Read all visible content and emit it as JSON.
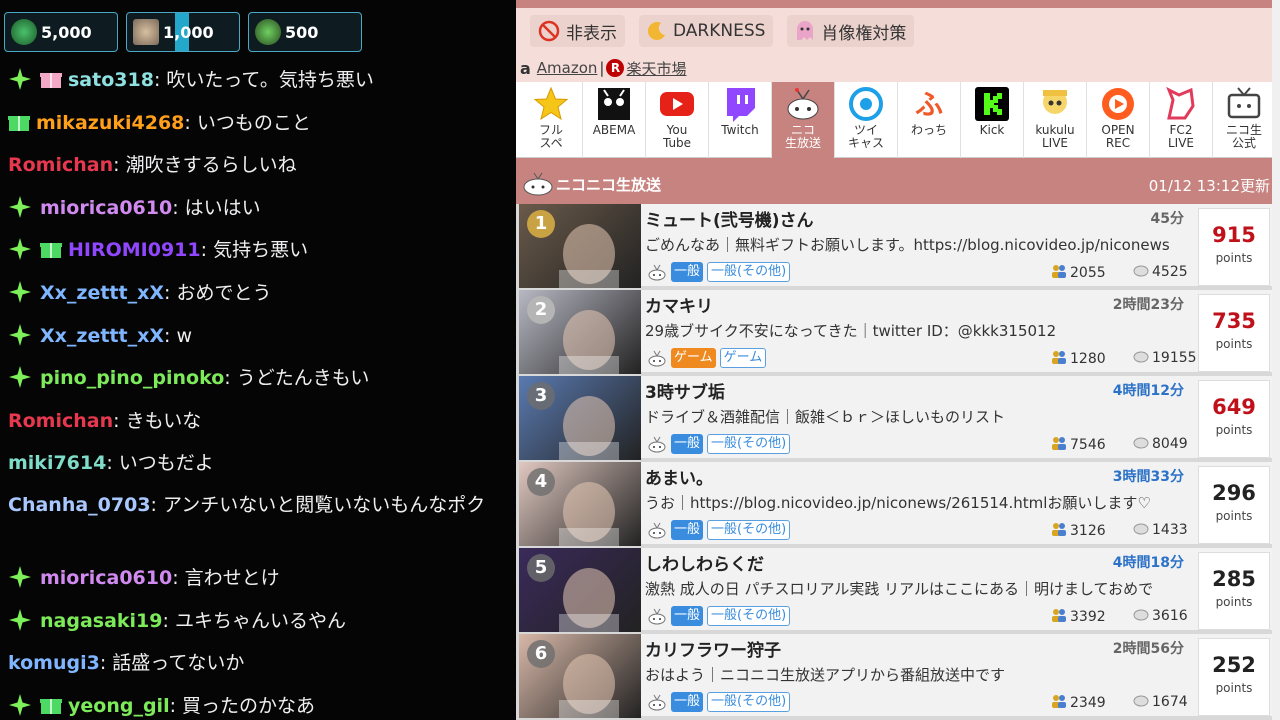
{
  "chat": {
    "badges": [
      {
        "value": "5,000",
        "icon": "emote-icon"
      },
      {
        "value": "1,000",
        "icon": "emote-icon"
      },
      {
        "value": "500",
        "icon": "emote-icon"
      }
    ],
    "messages": [
      {
        "user": "sato318",
        "color": "#8fe0e0",
        "text": ": 吹いたって。気持ち悪い",
        "sparkle": true,
        "gift": "pink"
      },
      {
        "user": "mikazuki4268",
        "color": "#ff9f1a",
        "text": ": いつものこと",
        "sparkle": false,
        "gift": "green"
      },
      {
        "user": "Romichan",
        "color": "#e8384f",
        "text": ": 潮吹きするらしいね",
        "sparkle": false,
        "gift": ""
      },
      {
        "user": "miorica0610",
        "color": "#d18af0",
        "text": ": はいはい",
        "sparkle": true,
        "gift": ""
      },
      {
        "user": "HIROMI0911",
        "color": "#9147ff",
        "text": ": 気持ち悪い",
        "sparkle": true,
        "gift": "green"
      },
      {
        "user": "Xx_zettt_xX",
        "color": "#7fb6ff",
        "text": ": おめでとう",
        "sparkle": true,
        "gift": ""
      },
      {
        "user": "Xx_zettt_xX",
        "color": "#7fb6ff",
        "text": ": w",
        "sparkle": true,
        "gift": ""
      },
      {
        "user": "pino_pino_pinoko",
        "color": "#7dea5a",
        "text": ": うどたんきもい",
        "sparkle": true,
        "gift": ""
      },
      {
        "user": "Romichan",
        "color": "#e8384f",
        "text": ": きもいな",
        "sparkle": false,
        "gift": ""
      },
      {
        "user": "miki7614",
        "color": "#7fdcc8",
        "text": ": いつもだよ",
        "sparkle": false,
        "gift": ""
      }
    ],
    "wrapped": {
      "user": "Chanha_0703",
      "color": "#a8c8ff",
      "text": ": アンチいないと閲覧いないもんなポク"
    },
    "messages2": [
      {
        "user": "miorica0610",
        "color": "#d18af0",
        "text": ": 言わせとけ",
        "sparkle": true,
        "gift": ""
      },
      {
        "user": "nagasaki19",
        "color": "#7dea5a",
        "text": ": ユキちゃんいるやん",
        "sparkle": true,
        "gift": ""
      },
      {
        "user": "komugi3",
        "color": "#7fb6ff",
        "text": ": 話盛ってないか",
        "sparkle": false,
        "gift": ""
      },
      {
        "user": "yeong_gil",
        "color": "#7dea5a",
        "text": ": 買ったのかなあ",
        "sparkle": true,
        "gift": "green"
      }
    ]
  },
  "tools": {
    "hide": "非表示",
    "darkness": "DARKNESS",
    "portrait": "肖像権対策"
  },
  "links": {
    "amazon": "Amazon",
    "sep": "|",
    "rakuten": "楽天市場"
  },
  "services": [
    {
      "label": "フル\nスペ",
      "icon": "star-icon"
    },
    {
      "label": "ABEMA",
      "icon": "abema-icon"
    },
    {
      "label": "You\nTube",
      "icon": "youtube-icon"
    },
    {
      "label": "Twitch",
      "icon": "twitch-icon"
    },
    {
      "label": "ニコ\n生放送",
      "icon": "niconico-icon"
    },
    {
      "label": "ツイ\nキャス",
      "icon": "twitcasting-icon"
    },
    {
      "label": "わっち",
      "icon": "wacchi-icon"
    },
    {
      "label": "Kick",
      "icon": "kick-icon"
    },
    {
      "label": "kukulu\nLIVE",
      "icon": "kukulu-icon"
    },
    {
      "label": "OPEN\nREC",
      "icon": "openrec-icon"
    },
    {
      "label": "FC2\nLIVE",
      "icon": "fc2-icon"
    },
    {
      "label": "ニコ生\n公式",
      "icon": "tv-icon"
    }
  ],
  "section": {
    "title": "ニコニコ生放送",
    "updated": "01/12 13:12更新"
  },
  "streams": [
    {
      "rank": "1",
      "title": "ミュート(弐号機)さん",
      "dur": "45分",
      "durBlue": false,
      "desc": "ごめんなあ｜無料ギフトお願いします。https://blog.nicovideo.jp/niconews",
      "cat": "一般",
      "catType": "gen",
      "sub": "一般(その他)",
      "viewers": "2055",
      "comments": "4525",
      "points": "915",
      "ptsRed": true,
      "thumb": "#6a5a4a"
    },
    {
      "rank": "2",
      "title": "カマキリ",
      "dur": "2時間23分",
      "durBlue": false,
      "desc": "29歳ブサイク不安になってきた｜twitter ID：@kkk315012",
      "cat": "ゲーム",
      "catType": "game",
      "sub": "ゲーム",
      "viewers": "1280",
      "comments": "19155",
      "points": "735",
      "ptsRed": true,
      "thumb": "#b8b8c4"
    },
    {
      "rank": "3",
      "title": "3時サブ垢",
      "dur": "4時間12分",
      "durBlue": true,
      "desc": "ドライブ＆酒雑配信｜飯雑＜ｂｒ＞ほしいものリスト",
      "cat": "一般",
      "catType": "gen",
      "sub": "一般(その他)",
      "viewers": "7546",
      "comments": "8049",
      "points": "649",
      "ptsRed": true,
      "thumb": "#5a7ab0"
    },
    {
      "rank": "4",
      "title": "あまい。",
      "dur": "3時間33分",
      "durBlue": true,
      "desc": "うお｜https://blog.nicovideo.jp/niconews/261514.htmlお願いします♡",
      "cat": "一般",
      "catType": "gen",
      "sub": "一般(その他)",
      "viewers": "3126",
      "comments": "1433",
      "points": "296",
      "ptsRed": false,
      "thumb": "#e0c8c0"
    },
    {
      "rank": "5",
      "title": "しわしわらくだ",
      "dur": "4時間18分",
      "durBlue": true,
      "desc": "激熱 成人の日 パチスロリアル実践 リアルはここにある｜明けましておめで",
      "cat": "一般",
      "catType": "gen",
      "sub": "一般(その他)",
      "viewers": "3392",
      "comments": "3616",
      "points": "285",
      "ptsRed": false,
      "thumb": "#3a2a5a"
    },
    {
      "rank": "6",
      "title": "カリフラワー狩子",
      "dur": "2時間56分",
      "durBlue": false,
      "desc": "おはよう｜ニコニコ生放送アプリから番組放送中です",
      "cat": "一般",
      "catType": "gen",
      "sub": "一般(その他)",
      "viewers": "2349",
      "comments": "1674",
      "points": "252",
      "ptsRed": false,
      "thumb": "#d8b8a8"
    }
  ],
  "pointsLabel": "points"
}
